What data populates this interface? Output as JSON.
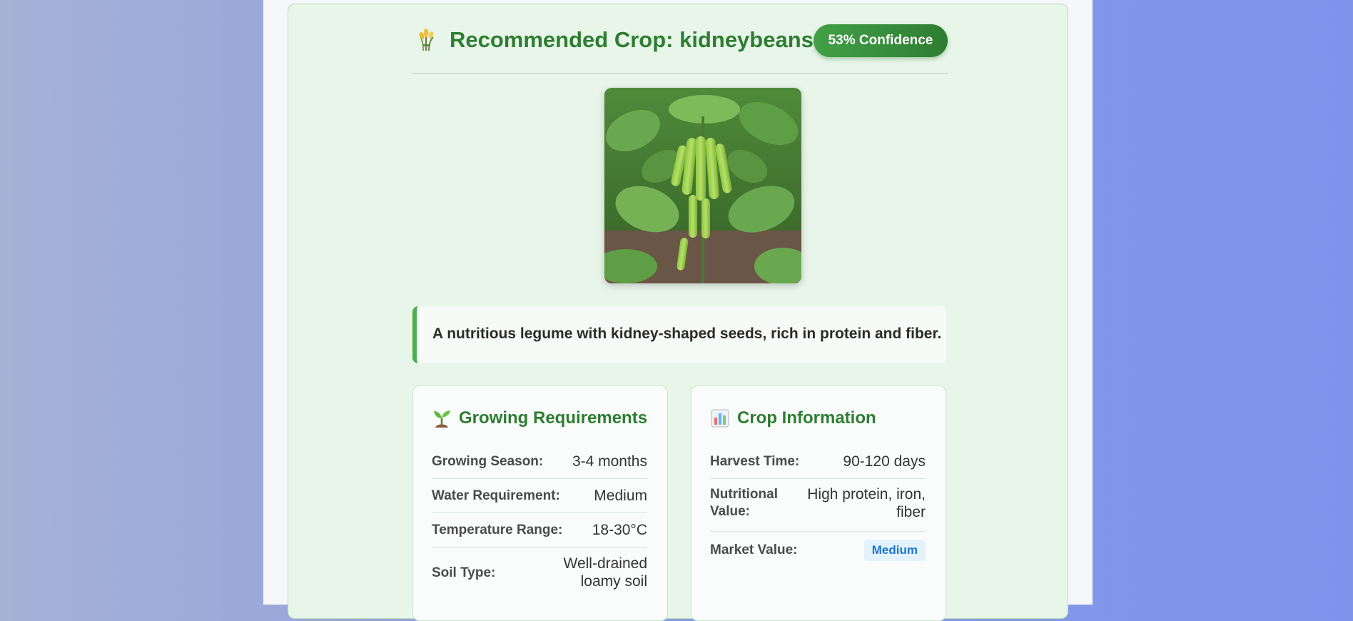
{
  "result": {
    "title": "Recommended Crop: kidneybeans",
    "confidence_badge": "53% Confidence",
    "description": "A nutritious legume with kidney-shaped seeds, rich in protein and fiber."
  },
  "growing_requirements": {
    "heading": "Growing Requirements",
    "rows": [
      {
        "label": "Growing Season:",
        "value": "3-4 months"
      },
      {
        "label": "Water Requirement:",
        "value": "Medium"
      },
      {
        "label": "Temperature Range:",
        "value": "18-30°C"
      },
      {
        "label": "Soil Type:",
        "value": "Well-drained loamy soil"
      }
    ]
  },
  "crop_information": {
    "heading": "Crop Information",
    "rows": [
      {
        "label": "Harvest Time:",
        "value": "90-120 days"
      },
      {
        "label": "Nutritional Value:",
        "value": "High protein, iron, fiber"
      },
      {
        "label": "Market Value:",
        "value": "Medium"
      }
    ]
  },
  "icons": {
    "title": "sheaf-of-rice-icon",
    "growing": "seedling-icon",
    "info": "bar-chart-icon"
  },
  "colors": {
    "accent_green": "#2e7d32",
    "card_background": "#e8f5e9",
    "market_pill_text": "#1976d2",
    "market_pill_bg": "#e3f2fd"
  }
}
